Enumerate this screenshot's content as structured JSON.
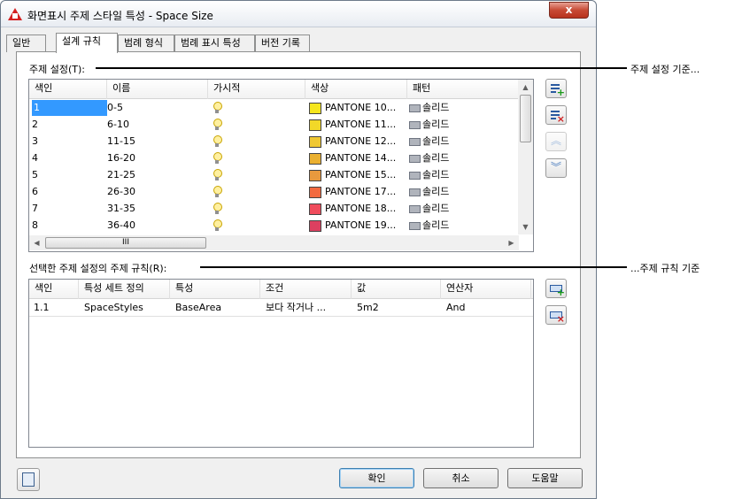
{
  "window": {
    "title": "화면표시 주제 스타일 특성 - Space Size",
    "close_label": "x"
  },
  "tabs": [
    {
      "label": "일반",
      "active": false
    },
    {
      "label": "설계 규칙",
      "active": true
    },
    {
      "label": "범례 형식",
      "active": false
    },
    {
      "label": "범례 표시 특성",
      "active": false
    },
    {
      "label": "버전 기록",
      "active": false
    }
  ],
  "theme_settings": {
    "label": "주제 설정(T):",
    "columns": [
      "색인",
      "이름",
      "가시적",
      "색상",
      "패턴"
    ],
    "rows": [
      {
        "index": "1",
        "name": "0-5",
        "color_name": "PANTONE 10...",
        "color": "#f5e61e",
        "pattern": "솔리드",
        "selected": true
      },
      {
        "index": "2",
        "name": "6-10",
        "color_name": "PANTONE 11...",
        "color": "#f2d828",
        "pattern": "솔리드"
      },
      {
        "index": "3",
        "name": "11-15",
        "color_name": "PANTONE 12...",
        "color": "#f0c832",
        "pattern": "솔리드"
      },
      {
        "index": "4",
        "name": "16-20",
        "color_name": "PANTONE 14...",
        "color": "#eab030",
        "pattern": "솔리드"
      },
      {
        "index": "5",
        "name": "21-25",
        "color_name": "PANTONE 15...",
        "color": "#e8993e",
        "pattern": "솔리드"
      },
      {
        "index": "6",
        "name": "26-30",
        "color_name": "PANTONE 17...",
        "color": "#f26a40",
        "pattern": "솔리드"
      },
      {
        "index": "7",
        "name": "31-35",
        "color_name": "PANTONE 18...",
        "color": "#f04c5c",
        "pattern": "솔리드"
      },
      {
        "index": "8",
        "name": "36-40",
        "color_name": "PANTONE 19...",
        "color": "#dc4060",
        "pattern": "솔리드"
      }
    ],
    "hscroll_mid": "III",
    "callout": "주제 설정 기준..."
  },
  "theme_rules": {
    "label": "선택한 주제 설정의 주제 규칙(R):",
    "columns": [
      "색인",
      "특성 세트 정의",
      "특성",
      "조건",
      "값",
      "연산자"
    ],
    "rows": [
      {
        "index": "1.1",
        "property_set": "SpaceStyles",
        "property": "BaseArea",
        "condition": "보다 작거나 ...",
        "value": "5m2",
        "operator": "And"
      }
    ],
    "callout": "...주제 규칙 기준"
  },
  "buttons": {
    "ok": "확인",
    "cancel": "취소",
    "help": "도움말"
  }
}
